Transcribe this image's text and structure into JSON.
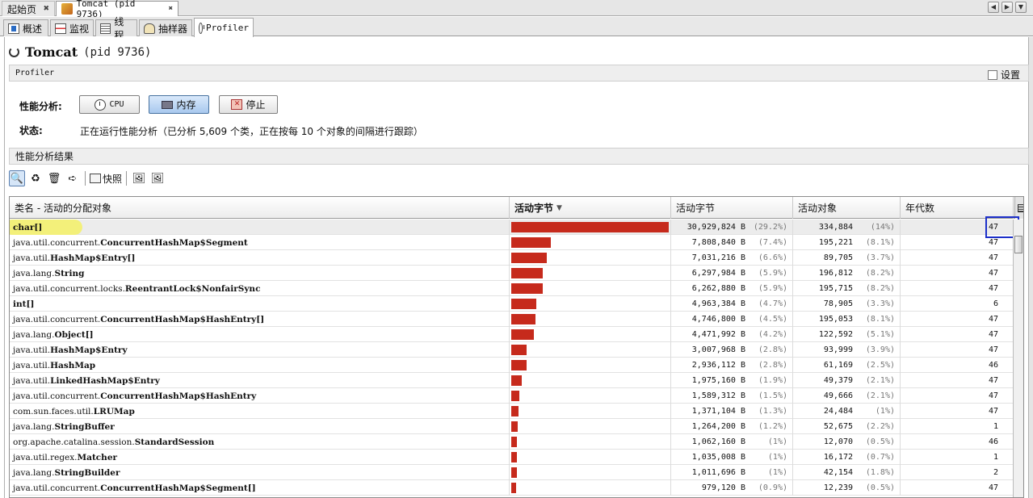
{
  "editor_tabs": [
    {
      "label": "起始页"
    },
    {
      "label": "Tomcat (pid 9736)"
    }
  ],
  "sub_tabs": [
    {
      "label": "概述"
    },
    {
      "label": "监视"
    },
    {
      "label": "线程"
    },
    {
      "label": "抽样器"
    },
    {
      "label": "Profiler"
    }
  ],
  "header": {
    "title": "Tomcat",
    "pid": "(pid 9736)"
  },
  "profiler_section": {
    "label": "Profiler",
    "settings_label": "设置"
  },
  "analysis": {
    "label": "性能分析:",
    "cpu_button": "CPU",
    "memory_button": "内存",
    "stop_button": "停止",
    "status_label": "状态:",
    "status_text": "正在运行性能分析（已分析 5,609 个类，正在按每 10 个对象的间隔进行跟踪）"
  },
  "results": {
    "label": "性能分析结果",
    "snapshot_label": "快照"
  },
  "table": {
    "columns": [
      "类名 - 活动的分配对象",
      "活动字节",
      "活动字节",
      "活动对象",
      "年代数"
    ],
    "rows": [
      {
        "prefix": "",
        "name": "char[]",
        "bytes": "30,929,824 B",
        "bytes_pct": "(29.2%)",
        "objects": "334,884",
        "objects_pct": "(14%)",
        "gens": "47",
        "share": 29.2
      },
      {
        "prefix": "java.util.concurrent.",
        "name": "ConcurrentHashMap$Segment",
        "bytes": "7,808,840 B",
        "bytes_pct": "(7.4%)",
        "objects": "195,221",
        "objects_pct": "(8.1%)",
        "gens": "47",
        "share": 7.4
      },
      {
        "prefix": "java.util.",
        "name": "HashMap$Entry[]",
        "bytes": "7,031,216 B",
        "bytes_pct": "(6.6%)",
        "objects": "89,705",
        "objects_pct": "(3.7%)",
        "gens": "47",
        "share": 6.6
      },
      {
        "prefix": "java.lang.",
        "name": "String",
        "bytes": "6,297,984 B",
        "bytes_pct": "(5.9%)",
        "objects": "196,812",
        "objects_pct": "(8.2%)",
        "gens": "47",
        "share": 5.9
      },
      {
        "prefix": "java.util.concurrent.locks.",
        "name": "ReentrantLock$NonfairSync",
        "bytes": "6,262,880 B",
        "bytes_pct": "(5.9%)",
        "objects": "195,715",
        "objects_pct": "(8.2%)",
        "gens": "47",
        "share": 5.9
      },
      {
        "prefix": "",
        "name": "int[]",
        "bytes": "4,963,384 B",
        "bytes_pct": "(4.7%)",
        "objects": "78,905",
        "objects_pct": "(3.3%)",
        "gens": "6",
        "share": 4.7
      },
      {
        "prefix": "java.util.concurrent.",
        "name": "ConcurrentHashMap$HashEntry[]",
        "bytes": "4,746,800 B",
        "bytes_pct": "(4.5%)",
        "objects": "195,053",
        "objects_pct": "(8.1%)",
        "gens": "47",
        "share": 4.5
      },
      {
        "prefix": "java.lang.",
        "name": "Object[]",
        "bytes": "4,471,992 B",
        "bytes_pct": "(4.2%)",
        "objects": "122,592",
        "objects_pct": "(5.1%)",
        "gens": "47",
        "share": 4.2
      },
      {
        "prefix": "java.util.",
        "name": "HashMap$Entry",
        "bytes": "3,007,968 B",
        "bytes_pct": "(2.8%)",
        "objects": "93,999",
        "objects_pct": "(3.9%)",
        "gens": "47",
        "share": 2.8
      },
      {
        "prefix": "java.util.",
        "name": "HashMap",
        "bytes": "2,936,112 B",
        "bytes_pct": "(2.8%)",
        "objects": "61,169",
        "objects_pct": "(2.5%)",
        "gens": "46",
        "share": 2.8
      },
      {
        "prefix": "java.util.",
        "name": "LinkedHashMap$Entry",
        "bytes": "1,975,160 B",
        "bytes_pct": "(1.9%)",
        "objects": "49,379",
        "objects_pct": "(2.1%)",
        "gens": "47",
        "share": 1.9
      },
      {
        "prefix": "java.util.concurrent.",
        "name": "ConcurrentHashMap$HashEntry",
        "bytes": "1,589,312 B",
        "bytes_pct": "(1.5%)",
        "objects": "49,666",
        "objects_pct": "(2.1%)",
        "gens": "47",
        "share": 1.5
      },
      {
        "prefix": "com.sun.faces.util.",
        "name": "LRUMap",
        "bytes": "1,371,104 B",
        "bytes_pct": "(1.3%)",
        "objects": "24,484",
        "objects_pct": "(1%)",
        "gens": "47",
        "share": 1.3
      },
      {
        "prefix": "java.lang.",
        "name": "StringBuffer",
        "bytes": "1,264,200 B",
        "bytes_pct": "(1.2%)",
        "objects": "52,675",
        "objects_pct": "(2.2%)",
        "gens": "1",
        "share": 1.2
      },
      {
        "prefix": "org.apache.catalina.session.",
        "name": "StandardSession",
        "bytes": "1,062,160 B",
        "bytes_pct": "(1%)",
        "objects": "12,070",
        "objects_pct": "(0.5%)",
        "gens": "46",
        "share": 1.0
      },
      {
        "prefix": "java.util.regex.",
        "name": "Matcher",
        "bytes": "1,035,008 B",
        "bytes_pct": "(1%)",
        "objects": "16,172",
        "objects_pct": "(0.7%)",
        "gens": "1",
        "share": 1.0
      },
      {
        "prefix": "java.lang.",
        "name": "StringBuilder",
        "bytes": "1,011,696 B",
        "bytes_pct": "(1%)",
        "objects": "42,154",
        "objects_pct": "(1.8%)",
        "gens": "2",
        "share": 1.0
      },
      {
        "prefix": "java.util.concurrent.",
        "name": "ConcurrentHashMap$Segment[]",
        "bytes": "979,120 B",
        "bytes_pct": "(0.9%)",
        "objects": "12,239",
        "objects_pct": "(0.5%)",
        "gens": "47",
        "share": 0.9
      }
    ]
  },
  "colors": {
    "bar": "#c62a1c",
    "highlight": "#f3f07a",
    "focus_box": "#1c2fc9"
  }
}
